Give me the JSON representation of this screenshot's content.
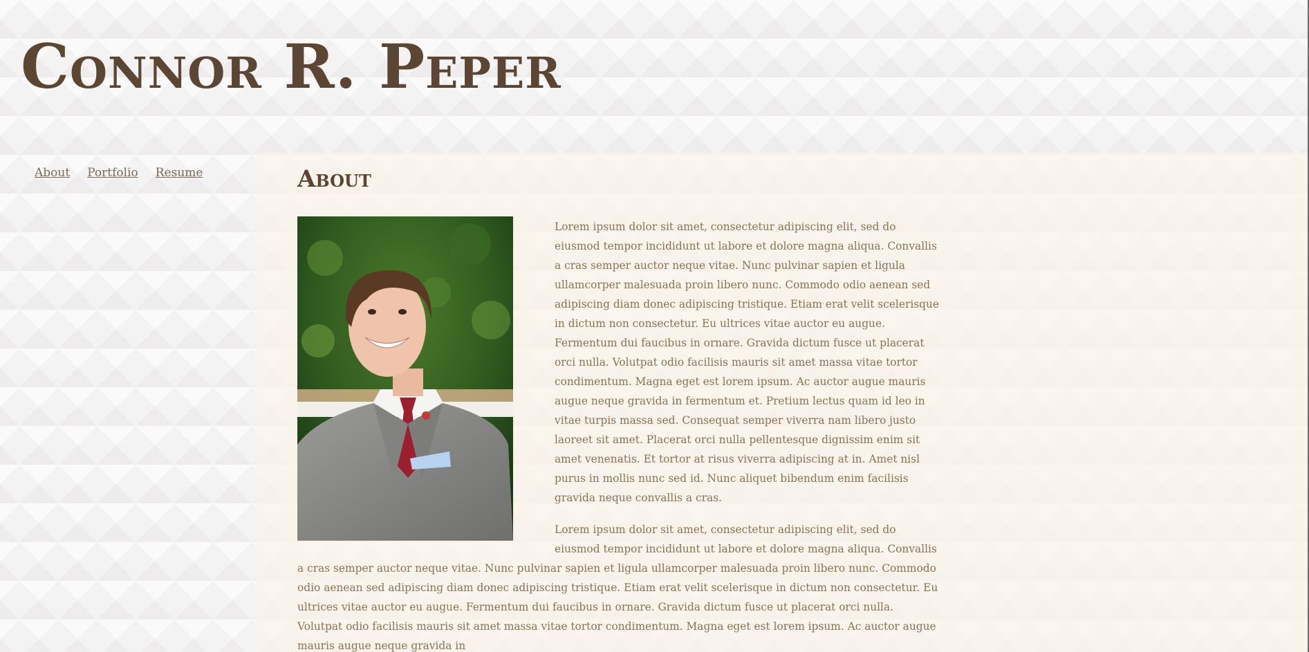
{
  "header": {
    "title": "Connor R. Peper"
  },
  "nav": {
    "items": [
      {
        "label": "About"
      },
      {
        "label": "Portfolio"
      },
      {
        "label": "Resume"
      }
    ]
  },
  "main": {
    "heading": "About",
    "photo_alt": "Portrait photo",
    "paragraphs": [
      "Lorem ipsum dolor sit amet, consectetur adipiscing elit, sed do eiusmod tempor incididunt ut labore et dolore magna aliqua. Convallis a cras semper auctor neque vitae. Nunc pulvinar sapien et ligula ullamcorper malesuada proin libero nunc. Commodo odio aenean sed adipiscing diam donec adipiscing tristique. Etiam erat velit scelerisque in dictum non consectetur. Eu ultrices vitae auctor eu augue. Fermentum dui faucibus in ornare. Gravida dictum fusce ut placerat orci nulla. Volutpat odio facilisis mauris sit amet massa vitae tortor condimentum. Magna eget est lorem ipsum. Ac auctor augue mauris augue neque gravida in fermentum et. Pretium lectus quam id leo in vitae turpis massa sed. Consequat semper viverra nam libero justo laoreet sit amet. Placerat orci nulla pellentesque dignissim enim sit amet venenatis. Et tortor at risus viverra adipiscing at in. Amet nisl purus in mollis nunc sed id. Nunc aliquet bibendum enim facilisis gravida neque convallis a cras.",
      "Lorem ipsum dolor sit amet, consectetur adipiscing elit, sed do eiusmod tempor incididunt ut labore et dolore magna aliqua. Convallis a cras semper auctor neque vitae. Nunc pulvinar sapien et ligula ullamcorper malesuada proin libero nunc. Commodo odio aenean sed adipiscing diam donec adipiscing tristique. Etiam erat velit scelerisque in dictum non consectetur. Eu ultrices vitae auctor eu augue. Fermentum dui faucibus in ornare. Gravida dictum fusce ut placerat orci nulla. Volutpat odio facilisis mauris sit amet massa vitae tortor condimentum. Magna eget est lorem ipsum. Ac auctor augue mauris augue neque gravida in"
    ]
  },
  "colors": {
    "title": "#5a4632",
    "body_text": "#8a7356",
    "nav_link": "#7a6a55",
    "content_bg": "#fbf4e8",
    "page_bg": "#f4f3f3"
  }
}
